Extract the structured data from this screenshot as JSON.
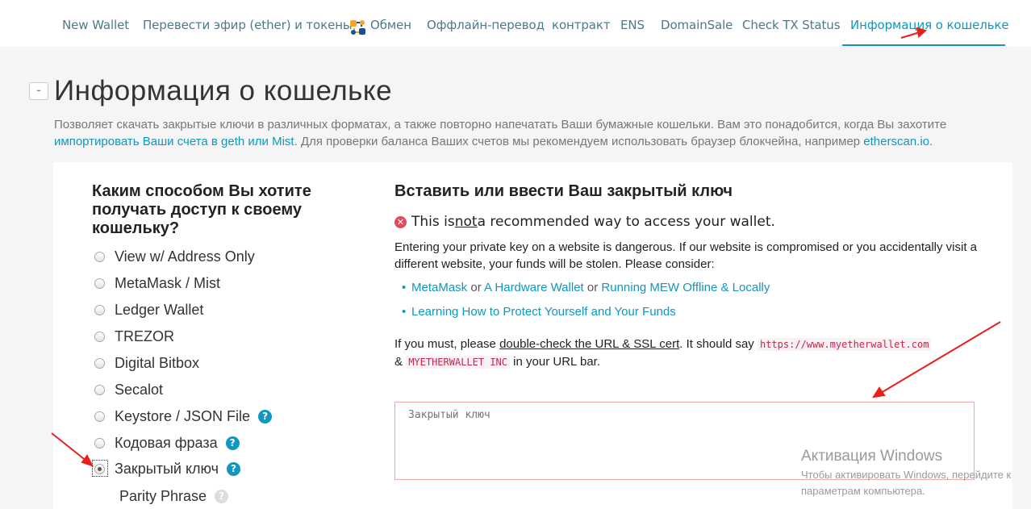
{
  "nav": {
    "items": [
      {
        "label": "New Wallet"
      },
      {
        "label": "Перевести эфир (ether) и токены"
      },
      {
        "label": "Обмен"
      },
      {
        "label": "Оффлайн-перевод"
      },
      {
        "label": "контракт"
      },
      {
        "label": "ENS"
      },
      {
        "label": "DomainSale"
      },
      {
        "label": "Check TX Status"
      },
      {
        "label": "Информация о кошельке"
      }
    ],
    "active_index": 8
  },
  "page": {
    "collapse_symbol": "-",
    "title": "Информация о кошельке",
    "desc_part1": "Позволяет скачать закрытые ключи в различных форматах, а также повторно напечатать Ваши бумажные кошельки. Вам это понадобится, когда Вы захотите ",
    "desc_link1": "импортировать Ваши счета в geth или Mist",
    "desc_part2": ". Для проверки баланса Ваших счетов мы рекомендуем использовать браузер блокчейна, например ",
    "desc_link2": "etherscan.io",
    "desc_part3": "."
  },
  "left": {
    "title": "Каким способом Вы хотите получать доступ к своему кошельку?",
    "options": [
      {
        "label": "View w/ Address Only",
        "checked": false,
        "help": false
      },
      {
        "label": "MetaMask / Mist",
        "checked": false,
        "help": false
      },
      {
        "label": "Ledger Wallet",
        "checked": false,
        "help": false
      },
      {
        "label": "TREZOR",
        "checked": false,
        "help": false
      },
      {
        "label": "Digital Bitbox",
        "checked": false,
        "help": false
      },
      {
        "label": "Secalot",
        "checked": false,
        "help": false
      },
      {
        "label": "Keystore / JSON File",
        "checked": false,
        "help": true
      },
      {
        "label": "Кодовая фраза",
        "checked": false,
        "help": true
      },
      {
        "label": "Закрытый ключ",
        "checked": true,
        "help": true
      },
      {
        "label": "Parity Phrase",
        "checked": false,
        "help": true
      }
    ],
    "help_symbol": "?"
  },
  "right": {
    "title": "Вставить или ввести Ваш закрытый ключ",
    "warn_icon": "✕",
    "warn_pre": "This is ",
    "warn_not": "not",
    "warn_post": " a recommended way to access your wallet.",
    "danger_text": "Entering your private key on a website is dangerous. If our website is compromised or you accidentally visit a different website, your funds will be stolen. Please consider:",
    "bullet1_link1": "MetaMask",
    "bullet1_or1": " or ",
    "bullet1_link2": "A Hardware Wallet",
    "bullet1_or2": " or ",
    "bullet1_link3": "Running MEW Offline & Locally",
    "bullet2_link": "Learning How to Protect Yourself and Your Funds",
    "must_pre": "If you must, please ",
    "must_link": "double-check the URL & SSL cert",
    "must_mid": ". It should say ",
    "must_url": "https://www.myetherwallet.com",
    "must_amp": "& ",
    "must_cert": "MYETHERWALLET INC",
    "must_post": " in your URL bar.",
    "input_placeholder": "Закрытый ключ"
  },
  "watermark": {
    "title": "Активация Windows",
    "line1": "Чтобы активировать Windows, перейдите к",
    "line2": "параметрам компьютера."
  },
  "colors": {
    "accent": "#0e97c0",
    "danger": "#e2495a",
    "annotation": "#e8201c"
  }
}
